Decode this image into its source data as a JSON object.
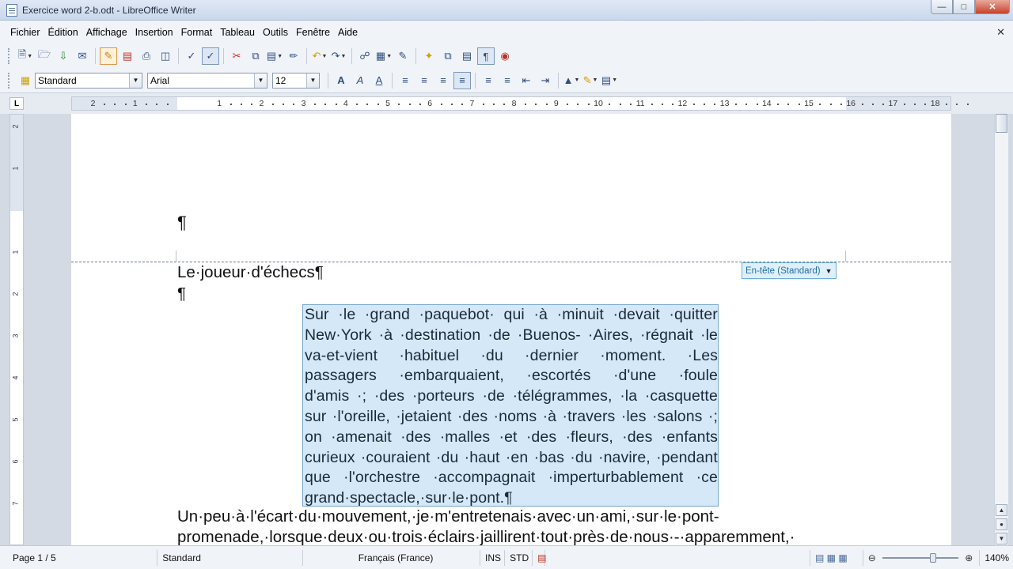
{
  "window": {
    "title": "Exercice word 2-b.odt - LibreOffice Writer"
  },
  "menu": [
    "Fichier",
    "Édition",
    "Affichage",
    "Insertion",
    "Format",
    "Tableau",
    "Outils",
    "Fenêtre",
    "Aide"
  ],
  "formatting": {
    "style": "Standard",
    "font": "Arial",
    "size": "12"
  },
  "ruler": {
    "ticks": [
      "2",
      "1",
      "1",
      "2",
      "3",
      "4",
      "5",
      "6",
      "7",
      "8",
      "9",
      "10",
      "11",
      "12",
      "13",
      "14",
      "15",
      "16",
      "17",
      "18"
    ],
    "vticks": [
      "2",
      "1",
      "1",
      "2",
      "3",
      "4",
      "5",
      "6",
      "7"
    ]
  },
  "document": {
    "pilcrow": "¶",
    "header_tag": "En-tête (Standard)",
    "heading": "Le·joueur·d'échecs¶",
    "quote_lines": [
      [
        "Sur",
        "·le",
        "·grand",
        "·paquebot·",
        "qui",
        "·à",
        "·minuit",
        "·devait",
        "·quitter"
      ],
      [
        "New·York",
        "·à",
        "·destination",
        "·de",
        "·Buenos-",
        "·Aires,",
        "·régnait",
        "·le"
      ],
      [
        "va-et-vient",
        "·habituel",
        "·du",
        "·dernier",
        "·moment.",
        "·Les"
      ],
      [
        "passagers",
        "·embarquaient,",
        "·escortés",
        "·d'une",
        "·foule"
      ],
      [
        "d'amis",
        "·;",
        "·des",
        "·porteurs",
        "·de",
        "·télégrammes,",
        "·la",
        "·casquette"
      ],
      [
        "sur",
        "·l'oreille,",
        "·jetaient",
        "·des",
        "·noms",
        "·à",
        "·travers",
        "·les",
        "·salons",
        "·;"
      ],
      [
        "on",
        "·amenait",
        "·des",
        "·malles",
        "·et",
        "·des",
        "·fleurs,",
        "·des",
        "·enfants"
      ],
      [
        "curieux",
        "·couraient",
        "·du",
        "·haut",
        "·en",
        "·bas",
        "·du",
        "·navire,",
        "·pendant"
      ],
      [
        "que",
        "·l'orchestre",
        "·accompagnait",
        "·imperturbablement",
        "·ce"
      ],
      [
        "grand·spectacle,·sur·le·pont.¶"
      ]
    ],
    "para_lines": [
      "Un·peu·à·l'écart·du·mouvement,·je·m'entretenais·avec·un·ami,·sur·le·pont-",
      "promenade,·lorsque·deux·ou·trois·éclairs·jaillirent·tout·près·de·nous·-·apparemment,·"
    ]
  },
  "status": {
    "page": "Page 1 / 5",
    "style": "Standard",
    "language": "Français (France)",
    "insert_mode": "INS",
    "selection_mode": "STD",
    "zoom": "140%"
  },
  "accent_colors": {
    "selection": "#d5e8f7",
    "header_tag_bg": "#dff0fb",
    "header_tag_border": "#6aaed4"
  }
}
